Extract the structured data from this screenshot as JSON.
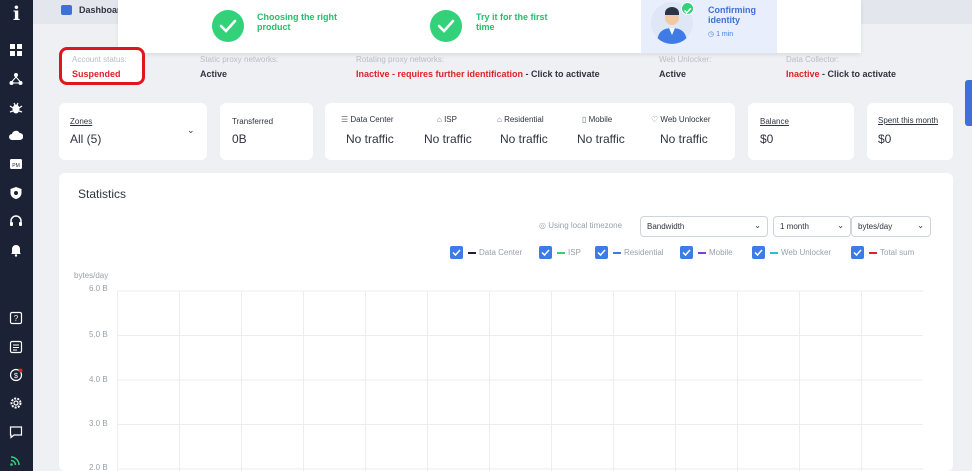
{
  "app": {
    "logo_letter": "i",
    "breadcrumb": "Dashboard"
  },
  "onboarding": {
    "steps": [
      {
        "label": "Choosing the right product",
        "state": "done"
      },
      {
        "label": "Try it for the first time",
        "state": "done"
      },
      {
        "label": "Confirming identity",
        "time": "1 min",
        "state": "current"
      }
    ]
  },
  "status": {
    "account": {
      "label": "Account status:",
      "value": "Suspended"
    },
    "static": {
      "label": "Static proxy networks:",
      "value": "Active"
    },
    "rotating": {
      "label": "Rotating proxy networks:",
      "value": "Inactive - requires further identification",
      "action": " - Click to activate"
    },
    "web_unlocker": {
      "label": "Web Unlocker:",
      "value": "Active"
    },
    "data_collector": {
      "label": "Data Collector:",
      "value": "Inactive",
      "action": " - Click to activate"
    }
  },
  "cards": {
    "zones": {
      "label": "Zones",
      "value": "All (5)"
    },
    "transferred": {
      "label": "Transferred",
      "value": "0B"
    },
    "traffic": [
      {
        "label": "Data Center",
        "value": "No traffic",
        "icon": "server-icon"
      },
      {
        "label": "ISP",
        "value": "No traffic",
        "icon": "building-icon"
      },
      {
        "label": "Residential",
        "value": "No traffic",
        "icon": "house-icon"
      },
      {
        "label": "Mobile",
        "value": "No traffic",
        "icon": "mobile-icon"
      },
      {
        "label": "Web Unlocker",
        "value": "No traffic",
        "icon": "shield-icon"
      }
    ],
    "balance": {
      "label": "Balance",
      "value": "$0"
    },
    "spent": {
      "label": "Spent this month",
      "value": "$0"
    }
  },
  "statistics": {
    "title": "Statistics",
    "timezone_label": "Using local timezone",
    "metric_select": "Bandwidth",
    "period_select": "1 month",
    "unit_select": "bytes/day",
    "legend": [
      {
        "label": "Data Center",
        "color": "#1c2235",
        "checked": true
      },
      {
        "label": "ISP",
        "color": "#33d17a",
        "checked": true
      },
      {
        "label": "Residential",
        "color": "#3f7be6",
        "checked": true
      },
      {
        "label": "Mobile",
        "color": "#7b3fe6",
        "checked": true
      },
      {
        "label": "Web Unlocker",
        "color": "#22c3d6",
        "checked": true
      },
      {
        "label": "Total sum",
        "color": "#e0212a",
        "checked": true
      }
    ],
    "y_unit": "bytes/day",
    "y_ticks": [
      "6.0 B",
      "5.0 B",
      "4.0 B",
      "3.0 B",
      "2.0 B"
    ]
  },
  "chart_data": {
    "type": "line",
    "title": "",
    "ylabel": "bytes/day",
    "y_tick_labels": [
      "6.0 B",
      "5.0 B",
      "4.0 B",
      "3.0 B",
      "2.0 B"
    ],
    "series": [
      {
        "name": "Data Center",
        "values": []
      },
      {
        "name": "ISP",
        "values": []
      },
      {
        "name": "Residential",
        "values": []
      },
      {
        "name": "Mobile",
        "values": []
      },
      {
        "name": "Web Unlocker",
        "values": []
      },
      {
        "name": "Total sum",
        "values": []
      }
    ],
    "grid": true
  }
}
